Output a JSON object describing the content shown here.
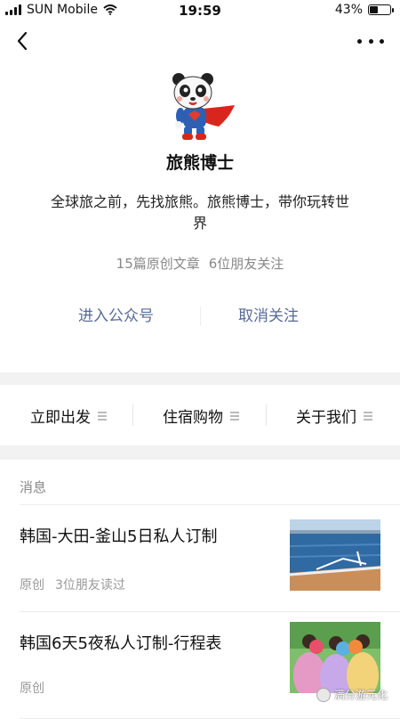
{
  "status_bar": {
    "carrier": "SUN Mobile",
    "time": "19:59",
    "battery_percent_text": "43%",
    "battery_level": 0.43
  },
  "nav": {
    "back_icon": "chevron-left-icon",
    "more_icon": "more-dots-icon"
  },
  "account": {
    "name": "旅熊博士",
    "description": "全球旅之前，先找旅熊。旅熊博士，带你玩转世界",
    "articles_count_text": "15篇原创文章",
    "friends_follow_text": "6位朋友关注"
  },
  "actions": {
    "enter_label": "进入公众号",
    "unfollow_label": "取消关注"
  },
  "menu": [
    {
      "label": "立即出发"
    },
    {
      "label": "住宿购物"
    },
    {
      "label": "关于我们"
    }
  ],
  "messages": {
    "section_label": "消息",
    "articles": [
      {
        "title": "韩国-大田-釜山5日私人订制",
        "tag": "原创",
        "reads": "3位朋友读过"
      },
      {
        "title": "韩国6天5夜私人订制-行程表",
        "tag": "原创",
        "reads": ""
      }
    ]
  },
  "watermark": {
    "text": "满分游元化"
  },
  "colors": {
    "link_blue": "#576b95",
    "muted_gray": "#888888",
    "band_gray": "#f2f2f2"
  }
}
